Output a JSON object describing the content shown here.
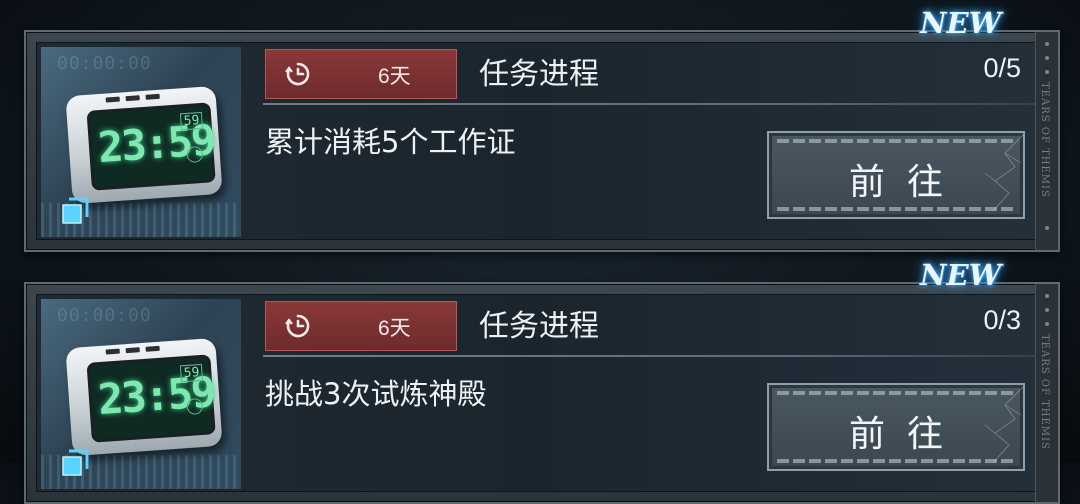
{
  "tasks": [
    {
      "badge": "NEW",
      "timer_days": "6天",
      "section_label": "任务进程",
      "progress": "0/5",
      "description": "累计消耗5个工作证",
      "go_label": "前往",
      "thumb_ghost": "00:00:00",
      "clock_digits": "23:59",
      "clock_seconds": "59",
      "side_text": "TEARS OF THEMIS"
    },
    {
      "badge": "NEW",
      "timer_days": "6天",
      "section_label": "任务进程",
      "progress": "0/3",
      "description": "挑战3次试炼神殿",
      "go_label": "前往",
      "thumb_ghost": "00:00:00",
      "clock_digits": "23:59",
      "clock_seconds": "59",
      "side_text": "TEARS OF THEMIS"
    }
  ],
  "colors": {
    "timer_bg": "#7a3131",
    "card_bg": "#2b333a",
    "accent_glow": "#4bb6ff",
    "clock_digits": "#7fe8b0"
  },
  "icons": {
    "timer": "clock-icon",
    "thumb_corner": "copy-icon"
  }
}
